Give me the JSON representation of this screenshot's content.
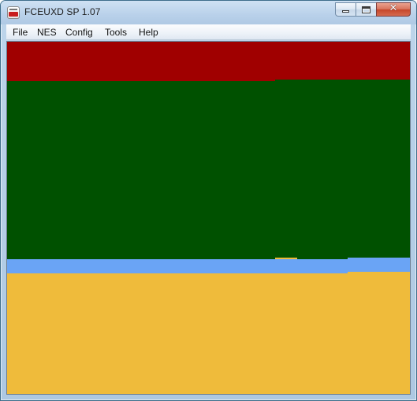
{
  "window": {
    "title": "FCEUXD SP 1.07",
    "icon": "fceuxd-icon",
    "controls": {
      "minimize": "minimize-icon",
      "maximize": "maximize-icon",
      "close_glyph": "✕"
    }
  },
  "menu": {
    "file": "File",
    "nes": "NES",
    "config": "Config",
    "tools": "Tools",
    "help": "Help"
  },
  "palette": {
    "red": "#a00000",
    "green": "#005100",
    "blue": "#6aa4f5",
    "yellow": "#efbb3b"
  }
}
